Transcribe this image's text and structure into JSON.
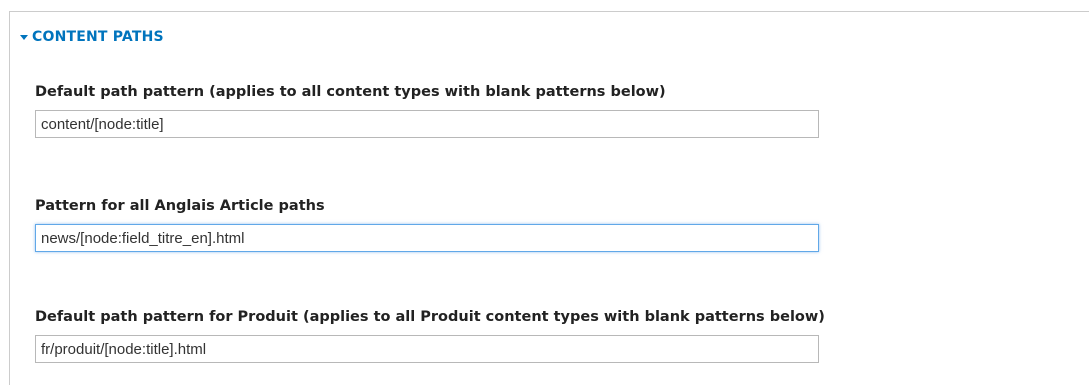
{
  "section": {
    "title": "CONTENT PATHS"
  },
  "fields": [
    {
      "label": "Default path pattern (applies to all content types with blank patterns below)",
      "value": "content/[node:title]"
    },
    {
      "label": "Pattern for all Anglais Article paths",
      "value": "news/[node:field_titre_en].html"
    },
    {
      "label": "Default path pattern for Produit (applies to all Produit content types with blank patterns below)",
      "value": "fr/produit/[node:title].html"
    }
  ]
}
